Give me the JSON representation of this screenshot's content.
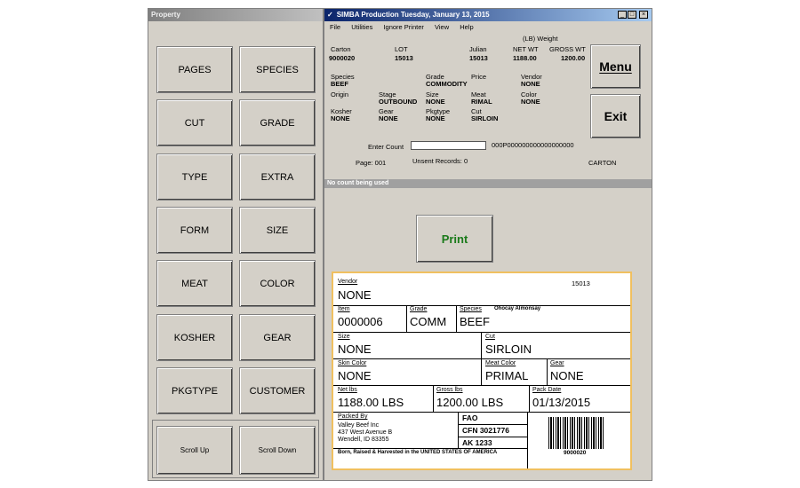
{
  "property_panel": {
    "title": "Property",
    "buttons": [
      "PAGES",
      "SPECIES",
      "CUT",
      "GRADE",
      "TYPE",
      "EXTRA",
      "FORM",
      "SIZE",
      "MEAT",
      "COLOR",
      "KOSHER",
      "GEAR",
      "PKGTYPE",
      "CUSTOMER"
    ],
    "scroll_up": "Scroll Up",
    "scroll_down": "Scroll Down"
  },
  "window": {
    "title": "SIMBA Production Tuesday, January 13, 2015",
    "menu": [
      "File",
      "Utilities",
      "Ignore Printer",
      "View",
      "Help"
    ],
    "controls": {
      "minimize": "_",
      "maximize": "□",
      "close": "×"
    }
  },
  "header": {
    "weight_caption": "(LB) Weight",
    "carton_label": "Carton",
    "carton": "9000020",
    "lot_label": "LOT",
    "lot": "15013",
    "julian_label": "Julian",
    "julian": "15013",
    "netwt_label": "NET WT",
    "netwt": "1188.00",
    "grosswt_label": "GROSS WT",
    "grosswt": "1200.00"
  },
  "fields": {
    "species_label": "Species",
    "species": "BEEF",
    "grade_label": "Grade",
    "grade": "COMMODITY",
    "price_label": "Price",
    "price": "",
    "vendor_label": "Vendor",
    "vendor": "NONE",
    "origin_label": "Origin",
    "origin": "",
    "stage_label": "Stage",
    "stage": "OUTBOUND",
    "size_label": "Size",
    "size": "NONE",
    "meat_label": "Meat",
    "meat": "RIMAL",
    "color_label": "Color",
    "color": "NONE",
    "kosher_label": "Kosher",
    "kosher": "NONE",
    "gear_label": "Gear",
    "gear": "NONE",
    "pkgtype_label": "Pkgtype",
    "pkgtype": "NONE",
    "cut_label": "Cut",
    "cut": "SIRLOIN"
  },
  "entry": {
    "enter_count_label": "Enter Count",
    "enter_count_value": "",
    "barcode_text": "000P000000000000000000",
    "page_text": "Page:  001",
    "unsent_text": "Unsent Records:  0",
    "mode": "CARTON"
  },
  "actions": {
    "menu": "Menu",
    "exit": "Exit",
    "print": "Print"
  },
  "status_bar": "No count being used",
  "label": {
    "vendor_label": "Vendor",
    "vendor": "NONE",
    "lot": "15013",
    "item_label": "Item",
    "item": "0000006",
    "grade_label": "Grade",
    "grade": "COMM",
    "species_label": "Species",
    "species": "BEEF",
    "customer_name": "Ohocay Almonsay",
    "size_label": "Size",
    "size": "NONE",
    "cut_label": "Cut",
    "cut": "SIRLOIN",
    "skin_label": "Skin Color",
    "skin": "NONE",
    "meat_label": "Meat Color",
    "meat": "PRIMAL",
    "gear_label": "Gear",
    "gear": "NONE",
    "net_label": "Net lbs",
    "net": "1188.00 LBS",
    "gross_label": "Gross lbs",
    "gross": "1200.00 LBS",
    "pack_label": "Pack Date",
    "pack": "01/13/2015",
    "packed_label": "Packed By",
    "packer_name": "Valley Beef Inc",
    "packer_addr1": "437 West Avenue B",
    "packer_addr2": "Wendell, ID 83355",
    "fao": "FAO",
    "cfn": "CFN 3021776",
    "ak": "AK 1233",
    "born": "Born, Raised & Harvested in the UNITED STATES OF AMERICA",
    "barcode_num": "9000020"
  }
}
